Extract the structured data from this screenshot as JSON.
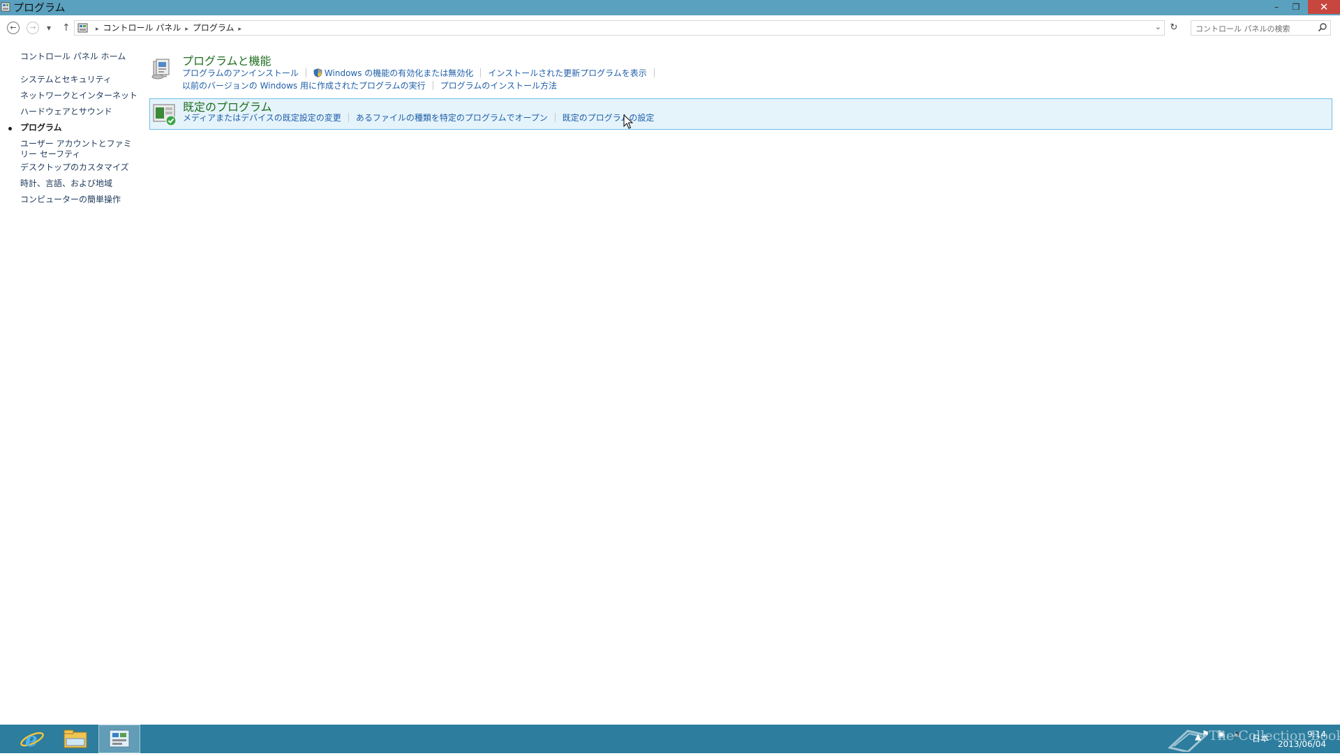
{
  "window": {
    "title": "プログラム",
    "minimize": "–",
    "maximize": "❐",
    "close": "✕"
  },
  "navbar": {
    "back": "←",
    "forward": "→",
    "recent": "▾",
    "up": "↑",
    "breadcrumbs": [
      "コントロール パネル",
      "プログラム"
    ],
    "sep": "▸",
    "dropdown": "⌄",
    "refresh": "↻",
    "search_placeholder": "コントロール パネルの検索"
  },
  "sidebar": {
    "home": "コントロール パネル ホーム",
    "items": [
      "システムとセキュリティ",
      "ネットワークとインターネット",
      "ハードウェアとサウンド",
      "プログラム",
      "ユーザー アカウントとファミリー セーフティ",
      "デスクトップのカスタマイズ",
      "時計、言語、および地域",
      "コンピューターの簡単操作"
    ],
    "current_index": 3
  },
  "categories": [
    {
      "heading": "プログラムと機能",
      "row1": [
        "プログラムのアンインストール",
        "Windows の機能の有効化または無効化",
        "インストールされた更新プログラムを表示"
      ],
      "row2": [
        "以前のバージョンの Windows 用に作成されたプログラムの実行",
        "プログラムのインストール方法"
      ]
    },
    {
      "heading": "既定のプログラム",
      "row1": [
        "メディアまたはデバイスの既定設定の変更",
        "あるファイルの種類を特定のプログラムでオープン",
        "既定のプログラムの設定"
      ]
    }
  ],
  "taskbar": {
    "tray_lang": "日本",
    "time": "9:14",
    "date": "2013/06/04",
    "watermark": "The Collection Book"
  },
  "colors": {
    "titlebar": "#5aa1bf",
    "taskbar": "#2c7d9e",
    "heading_green": "#1e6e1e",
    "link_blue": "#1e5ea8",
    "selection_bg": "#e5f3fb"
  }
}
